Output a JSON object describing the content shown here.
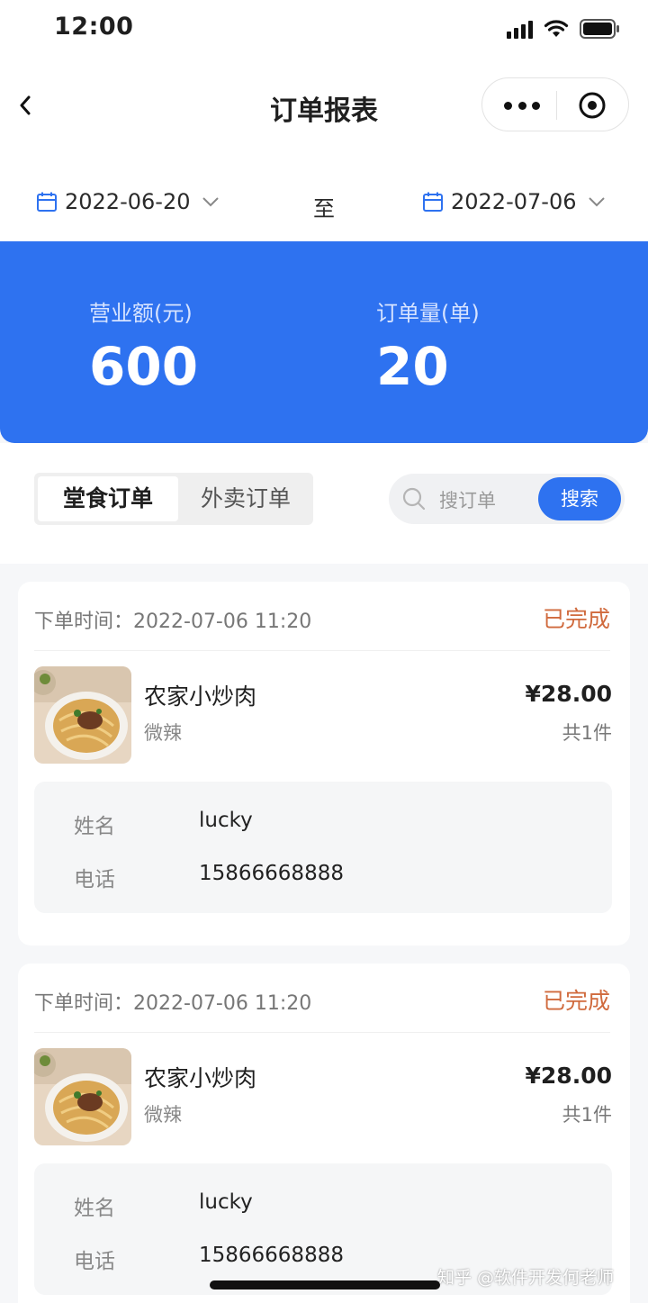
{
  "status_bar": {
    "time": "12:00"
  },
  "navbar": {
    "title": "订单报表"
  },
  "date_range": {
    "start": "2022-06-20",
    "separator": "至",
    "end": "2022-07-06"
  },
  "summary": {
    "revenue_label": "营业额(元)",
    "revenue_value": "600",
    "orders_label": "订单量(单)",
    "orders_value": "20"
  },
  "tabs": [
    {
      "label": "堂食订单",
      "active": true
    },
    {
      "label": "外卖订单",
      "active": false
    }
  ],
  "search": {
    "placeholder": "搜订单",
    "button": "搜索"
  },
  "orders": [
    {
      "time_label": "下单时间：",
      "time": "2022-07-06 11:20",
      "status": "已完成",
      "dish": "农家小炒肉",
      "flavor": "微辣",
      "price": "¥28.00",
      "qty": "共1件",
      "name_label": "姓名",
      "name": "lucky",
      "phone_label": "电话",
      "phone": "15866668888"
    },
    {
      "time_label": "下单时间：",
      "time": "2022-07-06 11:20",
      "status": "已完成",
      "dish": "农家小炒肉",
      "flavor": "微辣",
      "price": "¥28.00",
      "qty": "共1件",
      "name_label": "姓名",
      "name": "lucky",
      "phone_label": "电话",
      "phone": "15866668888"
    }
  ],
  "watermark": "知乎 @软件开发何老师",
  "colors": {
    "accent": "#2e72f0",
    "status_done": "#d06a3d"
  }
}
